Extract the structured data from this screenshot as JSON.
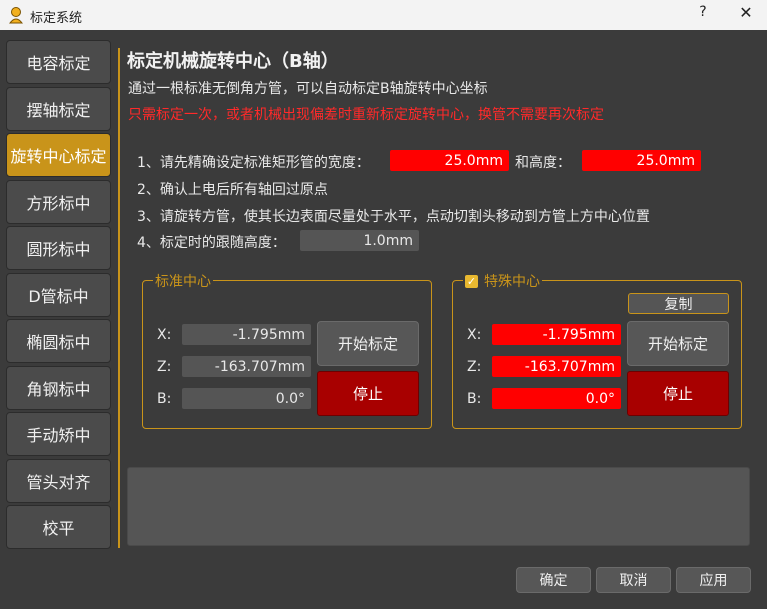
{
  "window": {
    "title": "标定系统",
    "help_label": "?",
    "close_label": "✕"
  },
  "sidebar": {
    "items": [
      {
        "label": "电容标定",
        "active": false
      },
      {
        "label": "摆轴标定",
        "active": false
      },
      {
        "label": "旋转中心标定",
        "active": true
      },
      {
        "label": "方形标中",
        "active": false
      },
      {
        "label": "圆形标中",
        "active": false
      },
      {
        "label": "D管标中",
        "active": false
      },
      {
        "label": "椭圆标中",
        "active": false
      },
      {
        "label": "角钢标中",
        "active": false
      },
      {
        "label": "手动矫中",
        "active": false
      },
      {
        "label": "管头对齐",
        "active": false
      },
      {
        "label": "校平",
        "active": false
      }
    ]
  },
  "colors": {
    "accent": "#c9941a",
    "warning": "#ff2a2a",
    "field_red": "#ff0000",
    "stop": "#a80000"
  },
  "header": {
    "title": "标定机械旋转中心（B轴）",
    "subtitle": "通过一根标准无倒角方管，可以自动标定B轴旋转中心坐标",
    "warning": "只需标定一次，或者机械出现偏差时重新标定旋转中心，换管不需要再次标定"
  },
  "steps": {
    "s1_prefix": "1、请先精确设定标准矩形管的宽度：",
    "width_value": "25.0mm",
    "s1_mid": "和高度：",
    "height_value": "25.0mm",
    "s2": "2、确认上电后所有轴回过原点",
    "s3": "3、请旋转方管，使其长边表面尽量处于水平，点动切割头移动到方管上方中心位置",
    "s4_prefix": "4、标定时的跟随高度：",
    "follow_height": "1.0mm"
  },
  "standard_center": {
    "legend": "标准中心",
    "x_label": "X:",
    "x_value": "-1.795mm",
    "z_label": "Z:",
    "z_value": "-163.707mm",
    "b_label": "B:",
    "b_value": "0.0°",
    "start_label": "开始标定",
    "stop_label": "停止"
  },
  "special_center": {
    "legend": "特殊中心",
    "checked": true,
    "copy_label": "复制",
    "x_label": "X:",
    "x_value": "-1.795mm",
    "z_label": "Z:",
    "z_value": "-163.707mm",
    "b_label": "B:",
    "b_value": "0.0°",
    "start_label": "开始标定",
    "stop_label": "停止"
  },
  "footer": {
    "ok_label": "确定",
    "cancel_label": "取消",
    "apply_label": "应用"
  }
}
